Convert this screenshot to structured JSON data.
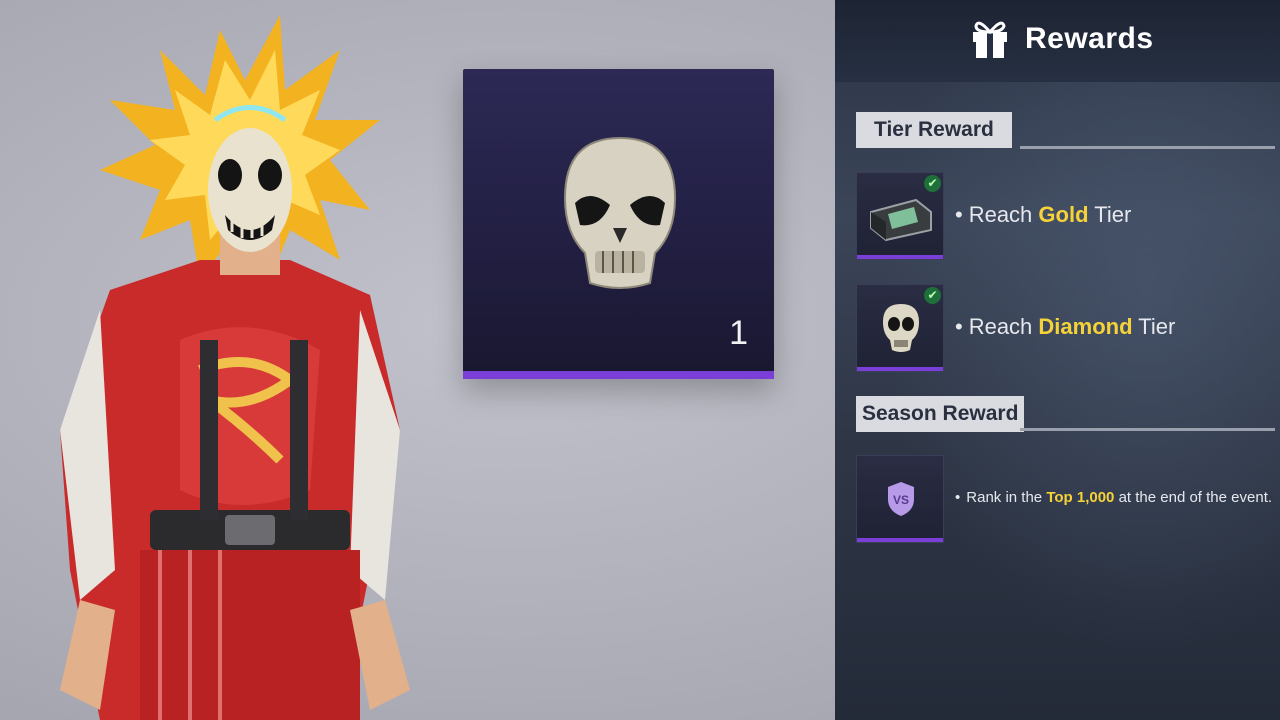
{
  "item_card": {
    "quantity": "1",
    "icon": "skull-mask-icon"
  },
  "character": {
    "icon": "character-skull-mask-outfit"
  },
  "rewards": {
    "title": "Rewards",
    "title_icon": "gift-icon",
    "tier_section": {
      "label": "Tier Reward",
      "items": [
        {
          "bullet": "•",
          "prefix": "Reach ",
          "highlight": "Gold",
          "suffix": " Tier",
          "icon": "crate-icon",
          "claimed": true
        },
        {
          "bullet": "•",
          "prefix": "Reach ",
          "highlight": "Diamond",
          "suffix": " Tier",
          "icon": "skull-mask-icon",
          "claimed": true
        }
      ]
    },
    "season_section": {
      "label": "Season Reward",
      "items": [
        {
          "bullet": "•",
          "prefix": "Rank in the ",
          "highlight": "Top 1,000",
          "suffix": " at the end of the event.",
          "icon": "vs-badge-icon"
        }
      ]
    },
    "colors": {
      "highlight": "#f6d23a",
      "accent": "#7a3fd6",
      "check": "#1e6f3a"
    }
  }
}
